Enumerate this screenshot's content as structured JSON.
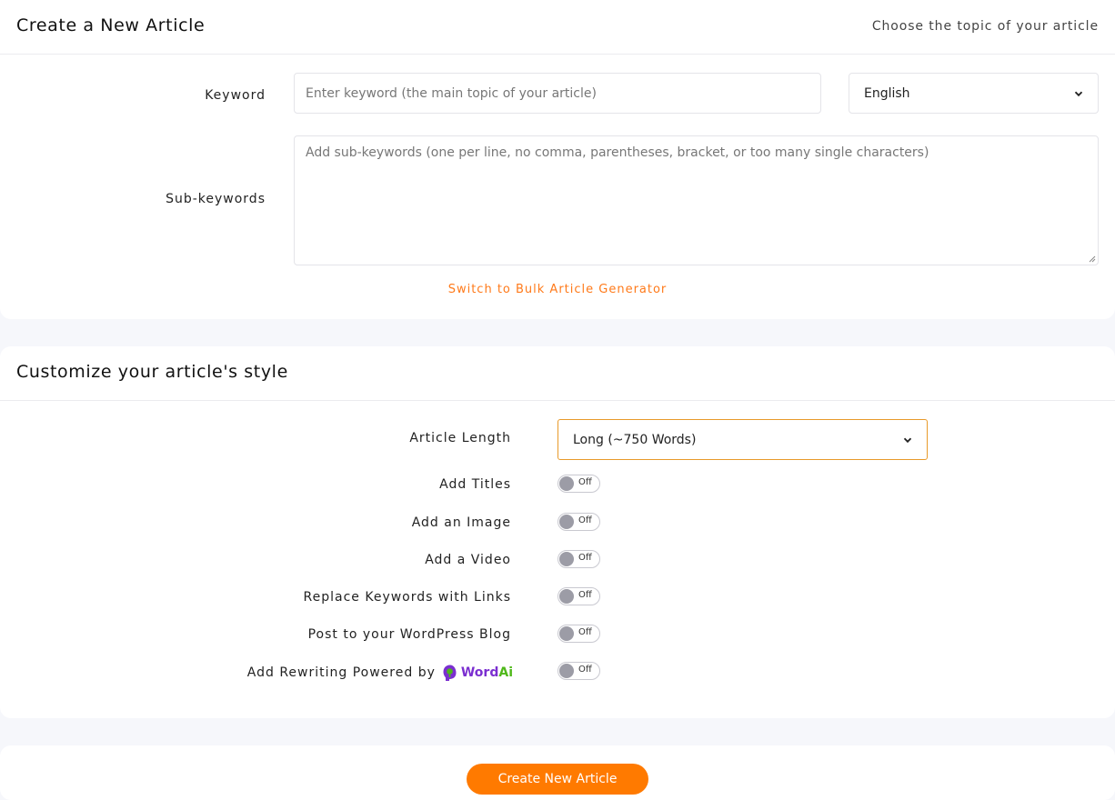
{
  "create_card": {
    "title": "Create a New Article",
    "subtitle": "Choose the topic of your article",
    "keyword_label": "Keyword",
    "keyword_placeholder": "Enter keyword (the main topic of your article)",
    "language_value": "English",
    "subkeywords_label": "Sub-keywords",
    "subkeywords_placeholder": "Add sub-keywords (one per line, no comma, parentheses, bracket, or too many single characters)",
    "bulk_link": "Switch to Bulk Article Generator"
  },
  "style_card": {
    "title": "Customize your article's style",
    "article_length_label": "Article Length",
    "article_length_value": "Long (~750 Words)",
    "options": [
      {
        "label": "Add Titles",
        "state": "Off"
      },
      {
        "label": "Add an Image",
        "state": "Off"
      },
      {
        "label": "Add a Video",
        "state": "Off"
      },
      {
        "label": "Replace Keywords with Links",
        "state": "Off"
      },
      {
        "label": "Post to your WordPress Blog",
        "state": "Off"
      },
      {
        "label": "Add Rewriting Powered by",
        "state": "Off"
      }
    ],
    "wordai_logo": "WordAi"
  },
  "actions": {
    "create_button": "Create New Article"
  },
  "colors": {
    "accent": "#ff7a00",
    "focus_border": "#e89a2a",
    "wordai_purple": "#7b2fd0",
    "wordai_green": "#4fb81a"
  }
}
